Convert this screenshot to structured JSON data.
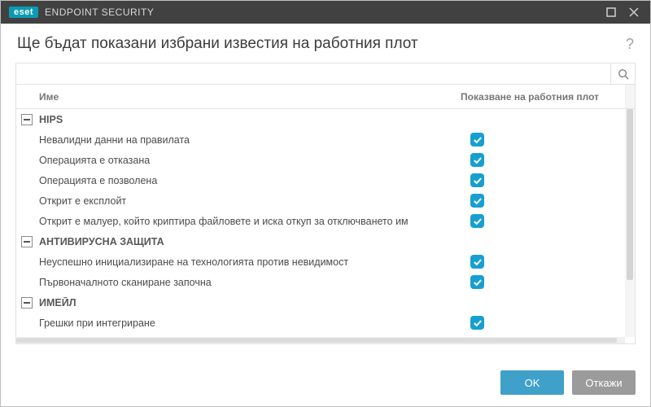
{
  "brand": {
    "badge": "eset",
    "name": "ENDPOINT SECURITY"
  },
  "heading": "Ще бъдат показани избрани известия на работния плот",
  "columns": {
    "name": "Име",
    "show": "Показване на работния плот"
  },
  "search": {
    "placeholder": ""
  },
  "groups": [
    {
      "title": "HIPS",
      "items": [
        {
          "label": "Невалидни данни на правилата",
          "checked": true
        },
        {
          "label": "Операцията е отказана",
          "checked": true
        },
        {
          "label": "Операцията е позволена",
          "checked": true
        },
        {
          "label": "Открит е експлойт",
          "checked": true
        },
        {
          "label": "Открит е малуер, който криптира файловете и иска откуп за отключването им",
          "checked": true
        }
      ]
    },
    {
      "title": "АНТИВИРУСНА ЗАЩИТА",
      "items": [
        {
          "label": "Неуспешно инициализиране на технологията против невидимост",
          "checked": true
        },
        {
          "label": "Първоначалното сканиране започна",
          "checked": true
        }
      ]
    },
    {
      "title": "ИМЕЙЛ",
      "items": [
        {
          "label": "Грешки при интегриране",
          "checked": true
        }
      ]
    }
  ],
  "buttons": {
    "ok": "OK",
    "cancel": "Откажи"
  }
}
